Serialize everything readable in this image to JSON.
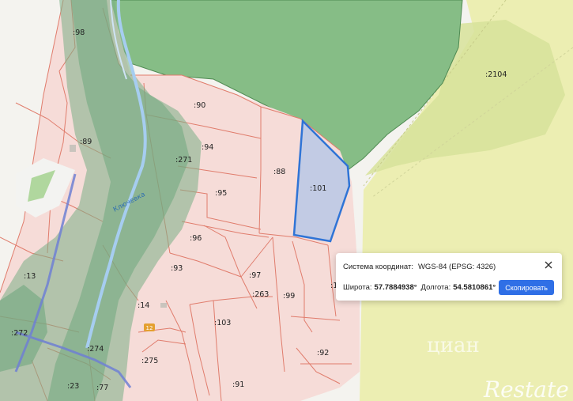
{
  "map": {
    "river_label": "Ключевка",
    "road_badge": "12",
    "watermark_top": "циан",
    "watermark_bottom": "Restate",
    "plots": [
      ":98",
      ":2104",
      ":90",
      ":89",
      ":94",
      ":271",
      ":88",
      ":101",
      ":95",
      ":96",
      ":93",
      ":13",
      ":97",
      ":263",
      ":99",
      ":1",
      ":14",
      ":272",
      ":274",
      ":103",
      ":92",
      ":275",
      ":23",
      ":77",
      ":91"
    ],
    "colors": {
      "parcel_fill": "#f5d9d6",
      "parcel_border": "#e07a6a",
      "forest": "#7cb77e",
      "meadow": "#e8ecaa",
      "river": "#9fc7ee",
      "selected_parcel": "#2f74d6",
      "district_line": "#6f7fd0"
    }
  },
  "popup": {
    "system_label": "Система координат:",
    "system_value": "WGS-84 (EPSG: 4326)",
    "lat_label": "Широта:",
    "lat_value": "57.7884938°",
    "lon_label": "Долгота:",
    "lon_value": "54.5810861°",
    "copy_button": "Скопировать",
    "close_icon": "close-icon"
  }
}
